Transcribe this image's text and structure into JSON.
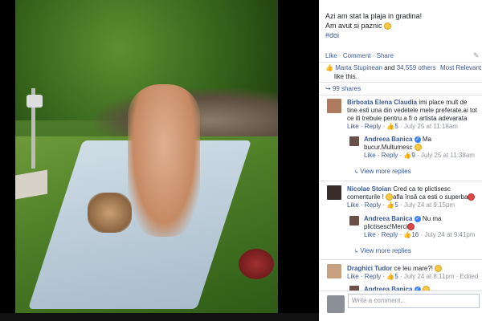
{
  "post": {
    "caption_line1": "Azi am stat la plaja in gradina!",
    "caption_line2": "Am avut si paznic",
    "hashtag": "#doi",
    "action_like": "Like",
    "action_comment": "Comment",
    "action_share": "Share",
    "likes_text_link1": "Marta Stupinean",
    "likes_text_and": " and ",
    "likes_text_link2": "34,559 others",
    "likes_text_tail": "like this.",
    "most_relevant": "Most Relevant",
    "shares": "99 shares"
  },
  "comments": [
    {
      "author": "Birboata Elena Claudia",
      "text": " imi place mult de tine.esti una din vedetele mele preferate.ai tot ce iti trebuie pentru a fi o artista adevarata",
      "like": "Like",
      "reply": "Reply",
      "likes": "5",
      "time": "July 25 at 11:18am"
    },
    {
      "author": "Andreea Banica",
      "text": " Ma bucur.Multumesc",
      "like": "Like",
      "reply": "Reply",
      "likes": "9",
      "time": "July 25 at 11:38am"
    },
    {
      "author": "Nicolae Stoian",
      "text": " Cred ca te plictisesc comenturile ! ",
      "text2": "afla însă ca esti o superba",
      "like": "Like",
      "reply": "Reply",
      "likes": "5",
      "time": "July 24 at 9:15pm"
    },
    {
      "author": "Andreea Banica",
      "text": " Nu ma plictisesc!Merci",
      "like": "Like",
      "reply": "Reply",
      "likes": "16",
      "time": "July 24 at 9:41pm"
    },
    {
      "author": "Draghici Tudor",
      "text": " ce leu mare?! ",
      "like": "Like",
      "reply": "Reply",
      "likes": "5",
      "time": "July 24 at 8:11pm",
      "edited": "Edited"
    },
    {
      "author": "Andreea Banica"
    }
  ],
  "view_more_1": "View more replies",
  "view_more_2": "View more replies",
  "write_placeholder": "Write a comment...",
  "colors": {
    "link": "#3b5998",
    "grey": "#90949c",
    "verified": "#3b82f6"
  }
}
